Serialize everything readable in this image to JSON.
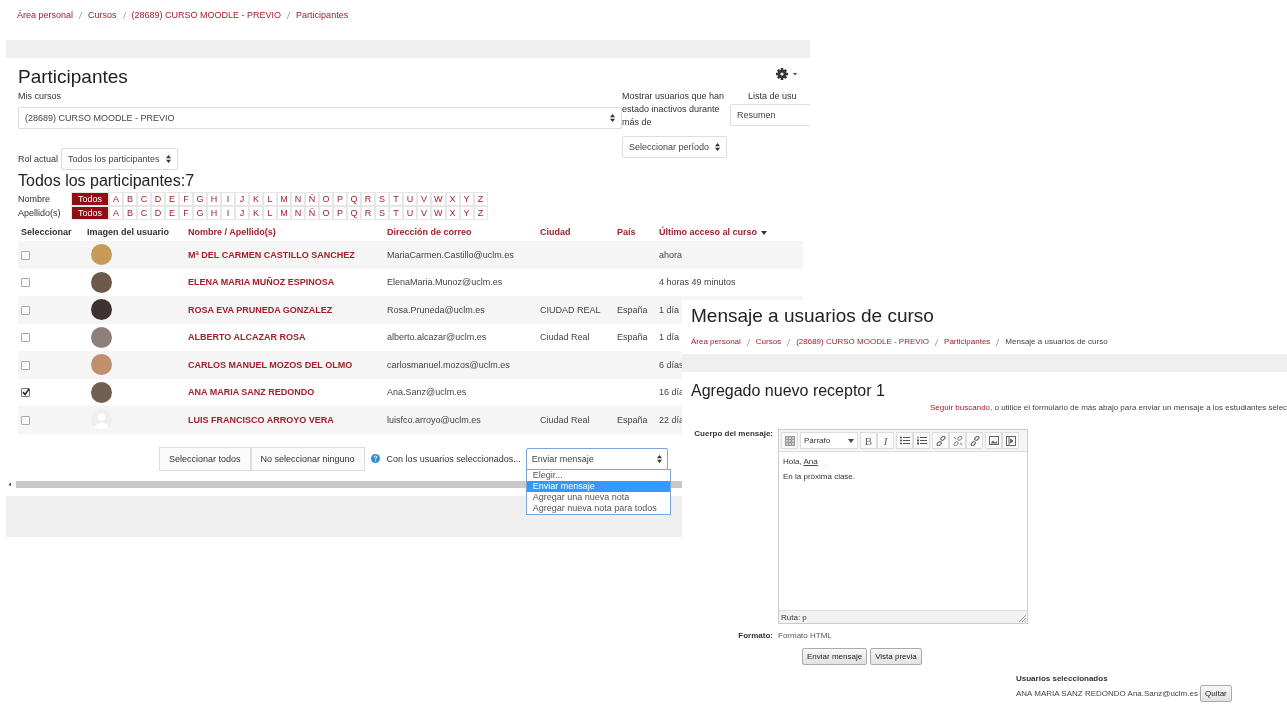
{
  "participants_page": {
    "breadcrumb": [
      "Área personal",
      "Cursos",
      "(28689) CURSO MOODLE - PREVIO",
      "Participantes"
    ],
    "title": "Participantes",
    "my_courses": {
      "label": "Mis cursos",
      "value": "(28689) CURSO MOODLE - PREVIO"
    },
    "inactive": {
      "label": "Mostrar usuarios que han estado inactivos durante más de",
      "value": "Seleccionar período"
    },
    "list_view": {
      "label": "Lista de usu",
      "value": "Resumen"
    },
    "role": {
      "label": "Rol actual",
      "value": "Todos los participantes"
    },
    "count_heading": "Todos los participantes:7",
    "initials": [
      {
        "label": "Nombre",
        "letters": [
          {
            "label": "Todos",
            "selected": true
          },
          {
            "label": "A",
            "selected": false
          },
          {
            "label": "B",
            "selected": false
          },
          {
            "label": "C",
            "selected": false
          },
          {
            "label": "D",
            "selected": false
          },
          {
            "label": "E",
            "selected": false
          },
          {
            "label": "F",
            "selected": false
          },
          {
            "label": "G",
            "selected": false
          },
          {
            "label": "H",
            "selected": false
          },
          {
            "label": "I",
            "selected": false
          },
          {
            "label": "J",
            "selected": false
          },
          {
            "label": "K",
            "selected": false
          },
          {
            "label": "L",
            "selected": false
          },
          {
            "label": "M",
            "selected": false
          },
          {
            "label": "N",
            "selected": false
          },
          {
            "label": "Ñ",
            "selected": false
          },
          {
            "label": "O",
            "selected": false
          },
          {
            "label": "P",
            "selected": false
          },
          {
            "label": "Q",
            "selected": false
          },
          {
            "label": "R",
            "selected": false
          },
          {
            "label": "S",
            "selected": false
          },
          {
            "label": "T",
            "selected": false
          },
          {
            "label": "U",
            "selected": false
          },
          {
            "label": "V",
            "selected": false
          },
          {
            "label": "W",
            "selected": false
          },
          {
            "label": "X",
            "selected": false
          },
          {
            "label": "Y",
            "selected": false
          },
          {
            "label": "Z",
            "selected": false
          }
        ]
      },
      {
        "label": "Apellido(s)",
        "letters": [
          {
            "label": "Todos",
            "selected": true
          },
          {
            "label": "A",
            "selected": false
          },
          {
            "label": "B",
            "selected": false
          },
          {
            "label": "C",
            "selected": false
          },
          {
            "label": "D",
            "selected": false
          },
          {
            "label": "E",
            "selected": false
          },
          {
            "label": "F",
            "selected": false
          },
          {
            "label": "G",
            "selected": false
          },
          {
            "label": "H",
            "selected": false
          },
          {
            "label": "I",
            "selected": false
          },
          {
            "label": "J",
            "selected": false
          },
          {
            "label": "K",
            "selected": false
          },
          {
            "label": "L",
            "selected": false
          },
          {
            "label": "M",
            "selected": false
          },
          {
            "label": "N",
            "selected": false
          },
          {
            "label": "Ñ",
            "selected": false
          },
          {
            "label": "O",
            "selected": false
          },
          {
            "label": "P",
            "selected": false
          },
          {
            "label": "Q",
            "selected": false
          },
          {
            "label": "R",
            "selected": false
          },
          {
            "label": "S",
            "selected": false
          },
          {
            "label": "T",
            "selected": false
          },
          {
            "label": "U",
            "selected": false
          },
          {
            "label": "V",
            "selected": false
          },
          {
            "label": "W",
            "selected": false
          },
          {
            "label": "X",
            "selected": false
          },
          {
            "label": "Y",
            "selected": false
          },
          {
            "label": "Z",
            "selected": false
          }
        ]
      }
    ],
    "table": {
      "columns": [
        "Seleccionar",
        "Imagen del usuario",
        "Nombre / Apellido(s)",
        "Dirección de correo",
        "Ciudad",
        "País",
        "Último acceso al curso"
      ],
      "rows": [
        {
          "checked": false,
          "kind": "photo",
          "name": "Mª DEL CARMEN CASTILLO SANCHEZ",
          "email": "MariaCarmen.Castillo@uclm.es",
          "city": "",
          "country": "",
          "last_access": "ahora"
        },
        {
          "checked": false,
          "kind": "photo",
          "name": "ELENA MARIA MUÑOZ ESPINOSA",
          "email": "ElenaMaria.Munoz@uclm.es",
          "city": "",
          "country": "",
          "last_access": "4 horas 49 minutos"
        },
        {
          "checked": false,
          "kind": "photo",
          "name": "ROSA EVA PRUNEDA GONZALEZ",
          "email": "Rosa.Pruneda@uclm.es",
          "city": "CIUDAD REAL",
          "country": "España",
          "last_access": "1 día"
        },
        {
          "checked": false,
          "kind": "photo",
          "name": "ALBERTO ALCAZAR ROSA",
          "email": "alberto.alcazar@uclm.es",
          "city": "Ciudad Real",
          "country": "España",
          "last_access": "1 día"
        },
        {
          "checked": false,
          "kind": "photo",
          "name": "CARLOS MANUEL MOZOS DEL OLMO",
          "email": "carlosmanuel.mozos@uclm.es",
          "city": "",
          "country": "",
          "last_access": "6 días"
        },
        {
          "checked": true,
          "kind": "photo",
          "name": "ANA MARIA SANZ REDONDO",
          "email": "Ana.Sanz@uclm.es",
          "city": "",
          "country": "",
          "last_access": "16 día"
        },
        {
          "checked": false,
          "kind": "default",
          "name": "LUIS FRANCISCO ARROYO VERA",
          "email": "luisfco.arroyo@uclm.es",
          "city": "Ciudad Real",
          "country": "España",
          "last_access": "22 día"
        }
      ]
    },
    "buttons": [
      "Seleccionar todos",
      "No seleccionar ninguno"
    ],
    "with_selected": {
      "label": "Con los usuarios seleccionados...",
      "value": "Enviar mensaje",
      "options": [
        {
          "label": "Elegir...",
          "selected": false
        },
        {
          "label": "Enviar mensaje",
          "selected": true
        },
        {
          "label": "Agregar una nueva nota",
          "selected": false
        },
        {
          "label": "Agregar nueva nota para todos",
          "selected": false
        }
      ]
    }
  },
  "message_page": {
    "title": "Mensaje a usuarios de curso",
    "breadcrumb": [
      "Área personal",
      "Cursos",
      "(28689) CURSO MOODLE - PREVIO",
      "Participantes",
      "Mensaje a usuarios de curso"
    ],
    "heading": "Agregado nuevo receptor 1",
    "notice": {
      "link": "Seguir buscando",
      "text": ", o utilice el formulario de más abajo para enviar un mensaje a los estudiantes selec"
    },
    "body_label": "Cuerpo del mensaje:",
    "editor": {
      "format_select": "Párrafo",
      "bold": "B",
      "italic": "I",
      "greeting": "Hola, ",
      "misspelled": "Ana",
      "line_2": "En la próxima clase.",
      "path": "Ruta: p"
    },
    "format": {
      "label": "Formato:",
      "value": "Formato HTML"
    },
    "buttons": [
      "Enviar mensaje",
      "Vista previa"
    ],
    "selected_heading": "Usuarios seleccionados",
    "selected_users": [
      {
        "text": "ANA MARIA SANZ REDONDO Ana.Sanz@uclm.es",
        "button": "Quitar"
      }
    ]
  }
}
